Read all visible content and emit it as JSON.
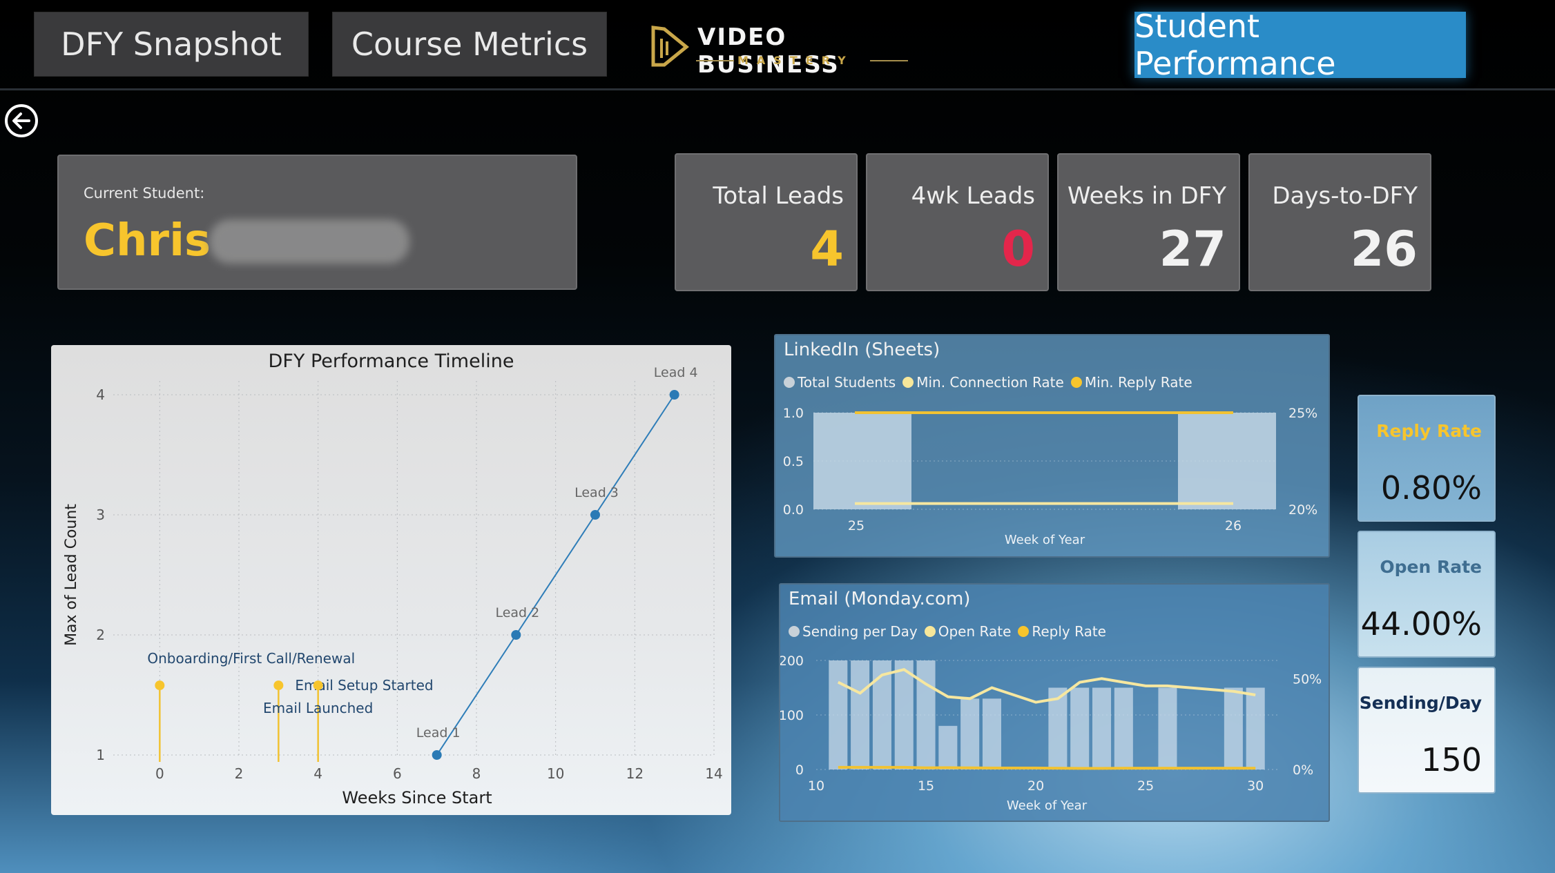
{
  "nav": {
    "tab1": "DFY Snapshot",
    "tab2": "Course Metrics",
    "tab3": "Student Performance",
    "logo_line1": "VIDEO BUSINESS",
    "logo_line2": "MASTERY"
  },
  "student": {
    "label": "Current Student:",
    "name": "Chris"
  },
  "kpis": [
    {
      "label": "Total Leads",
      "value": "4",
      "color": "#f7c52d"
    },
    {
      "label": "4wk Leads",
      "value": "0",
      "color": "#e3264b"
    },
    {
      "label": "Weeks in DFY",
      "value": "27",
      "color": "#f2f2f2"
    },
    {
      "label": "Days-to-DFY",
      "value": "26",
      "color": "#f2f2f2"
    }
  ],
  "timeline": {
    "title": "DFY Performance Timeline",
    "xlabel": "Weeks Since Start",
    "ylabel": "Max of Lead Count"
  },
  "linkedin": {
    "title": "LinkedIn (Sheets)",
    "legend": [
      "Total Students",
      "Min. Connection Rate",
      "Min. Reply Rate"
    ],
    "xlabel": "Week of Year"
  },
  "email": {
    "title": "Email (Monday.com)",
    "legend": [
      "Sending per Day",
      "Open Rate",
      "Reply Rate"
    ],
    "xlabel": "Week of Year"
  },
  "rates": [
    {
      "label": "Reply Rate",
      "value": "0.80%"
    },
    {
      "label": "Open Rate",
      "value": "44.00%"
    },
    {
      "label": "Sending/Day",
      "value": "150"
    }
  ],
  "colors": {
    "gold": "#f7c52d",
    "blue": "#2a8cc8",
    "pale_yellow": "#f7e79a",
    "grey_dot": "#c8d1d8"
  },
  "chart_data": [
    {
      "type": "scatter",
      "title": "DFY Performance Timeline",
      "xlabel": "Weeks Since Start",
      "ylabel": "Max of Lead Count",
      "xlim": [
        -1,
        14
      ],
      "ylim": [
        1,
        4
      ],
      "xticks": [
        "0",
        "2",
        "4",
        "6",
        "8",
        "10",
        "12",
        "14"
      ],
      "yticks": [
        "1",
        "2",
        "3",
        "4"
      ],
      "series": [
        {
          "name": "Leads",
          "points": [
            {
              "x": 7,
              "y": 1,
              "label": "Lead 1"
            },
            {
              "x": 9,
              "y": 2,
              "label": "Lead 2"
            },
            {
              "x": 11,
              "y": 3,
              "label": "Lead 3"
            },
            {
              "x": 13,
              "y": 4,
              "label": "Lead 4"
            }
          ]
        },
        {
          "name": "Events",
          "points": [
            {
              "x": 0,
              "y": 1.58,
              "label": "Onboarding/First Call/Renewal"
            },
            {
              "x": 3,
              "y": 1.58,
              "label": "Email Setup Started"
            },
            {
              "x": 4,
              "y": 1.58,
              "label": "Email Launched"
            }
          ]
        }
      ]
    },
    {
      "type": "bar",
      "title": "LinkedIn (Sheets)",
      "xlabel": "Week of Year",
      "x": [
        25,
        26
      ],
      "ylim": [
        0,
        1.0
      ],
      "yticks": [
        "0.0",
        "0.5",
        "1.0"
      ],
      "y2ticks": [
        "20%",
        "25%"
      ],
      "series": [
        {
          "name": "Total Students",
          "values": [
            1,
            1
          ]
        },
        {
          "name": "Min. Connection Rate",
          "values": [
            20.3,
            20.3
          ]
        },
        {
          "name": "Min. Reply Rate",
          "values": [
            25.0,
            25.0
          ]
        }
      ]
    },
    {
      "type": "bar",
      "title": "Email (Monday.com)",
      "xlabel": "Week of Year",
      "x": [
        11,
        12,
        13,
        14,
        15,
        16,
        17,
        18,
        19,
        20,
        21,
        22,
        23,
        24,
        25,
        26,
        27,
        28,
        29,
        30
      ],
      "ylim": [
        0,
        200
      ],
      "yticks": [
        "0",
        "100",
        "200"
      ],
      "xticks": [
        "10",
        "15",
        "20",
        "25",
        "30"
      ],
      "y2ticks": [
        "0%",
        "50%"
      ],
      "series": [
        {
          "name": "Sending per Day",
          "values": [
            200,
            200,
            200,
            200,
            200,
            80,
            130,
            130,
            0,
            0,
            150,
            150,
            150,
            150,
            0,
            150,
            0,
            0,
            150,
            150
          ]
        },
        {
          "name": "Open Rate",
          "values": [
            48,
            42,
            52,
            55,
            47,
            40,
            39,
            45,
            41,
            37,
            39,
            48,
            50,
            48,
            46,
            46,
            45,
            44,
            43,
            41
          ]
        },
        {
          "name": "Reply Rate",
          "values": [
            1.2,
            1.2,
            1.2,
            1.2,
            0.9,
            1.0,
            0.9,
            0.8,
            0.8,
            0.8,
            0.7,
            0.6,
            0.6,
            0.7,
            0.7,
            0.7,
            0.7,
            0.7,
            0.7,
            0.7
          ]
        }
      ]
    }
  ]
}
